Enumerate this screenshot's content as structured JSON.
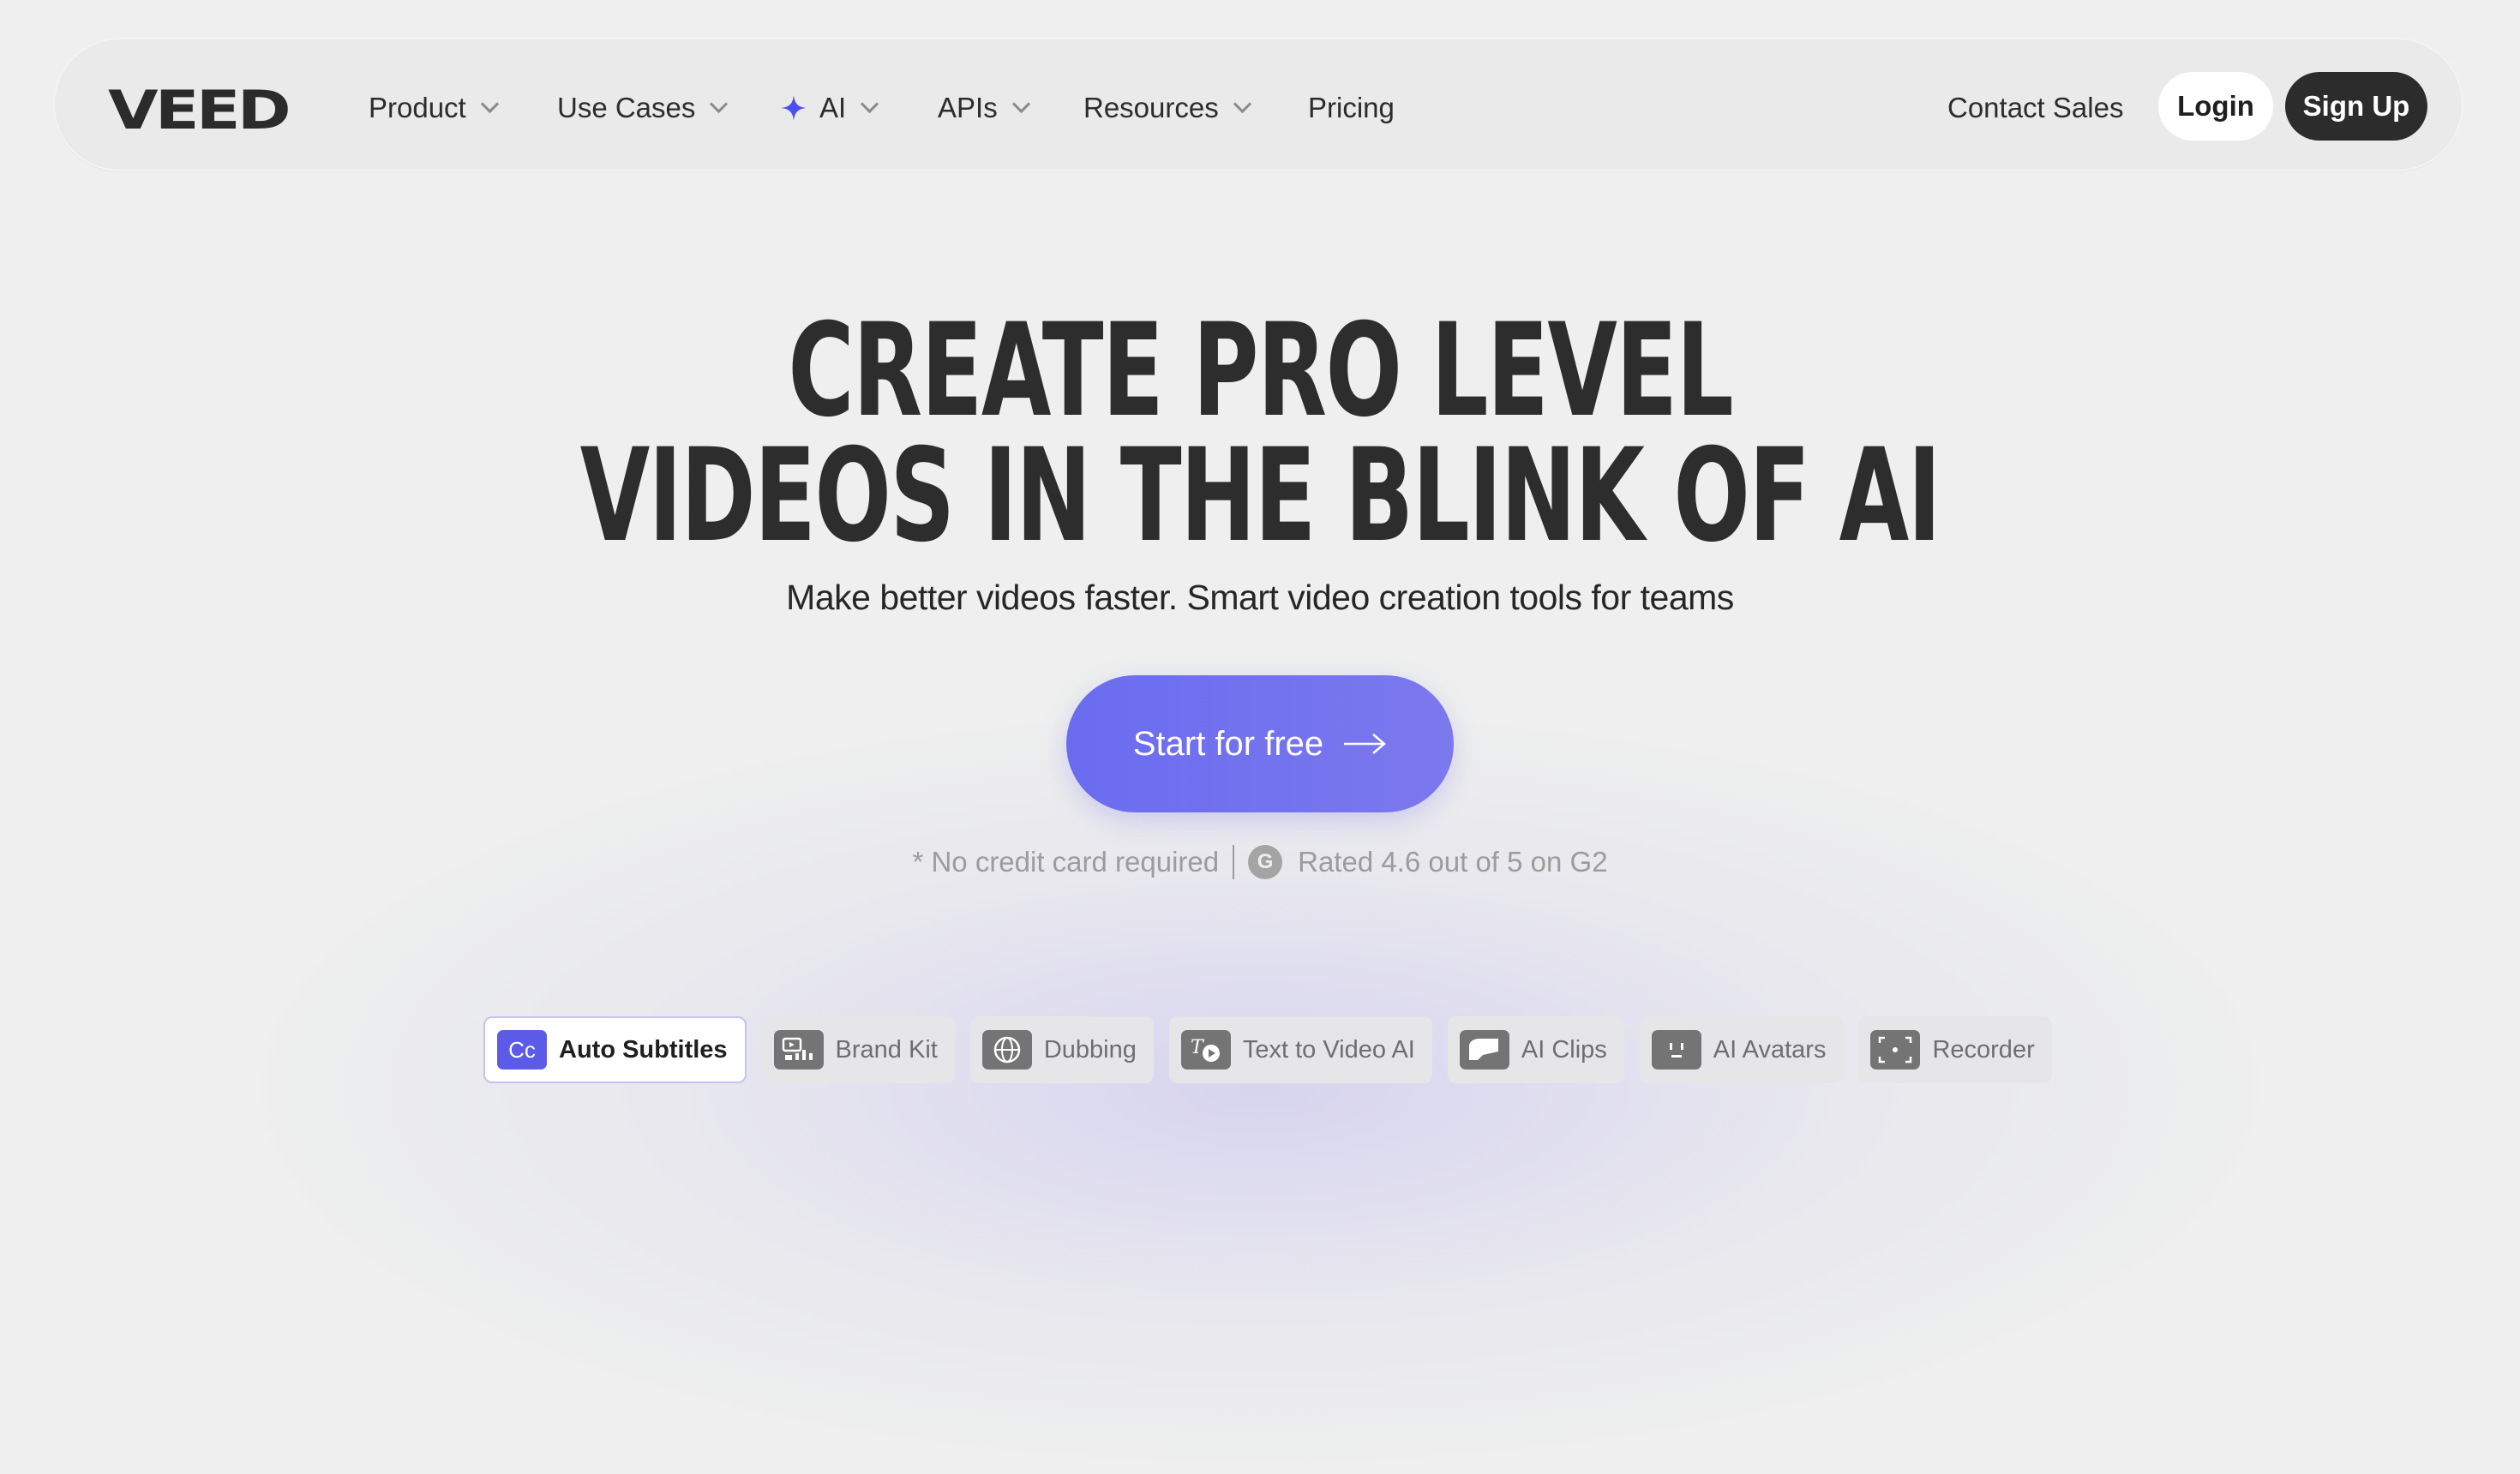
{
  "brand": {
    "logo_text": "VEED",
    "accent_color": "#6a6cf0",
    "ai_icon_color": "#4b4ef0"
  },
  "nav": {
    "items": [
      {
        "label": "Product",
        "has_dropdown": true
      },
      {
        "label": "Use Cases",
        "has_dropdown": true
      },
      {
        "label": "AI",
        "has_dropdown": true,
        "icon": "sparkle-icon"
      },
      {
        "label": "APIs",
        "has_dropdown": true
      },
      {
        "label": "Resources",
        "has_dropdown": true
      },
      {
        "label": "Pricing",
        "has_dropdown": false
      }
    ],
    "contact_sales": "Contact Sales",
    "login": "Login",
    "signup": "Sign Up"
  },
  "hero": {
    "headline_line1": "CREATE PRO LEVEL",
    "headline_line2": "VIDEOS IN THE BLINK OF AI",
    "subtitle": "Make better videos faster. Smart video creation tools for teams",
    "cta_label": "Start for free",
    "no_card": "* No credit card required",
    "rating": "Rated 4.6 out of 5 on G2"
  },
  "feature_tabs": [
    {
      "label": "Auto Subtitles",
      "icon": "captions-icon",
      "icon_text": "Cc",
      "active": true
    },
    {
      "label": "Brand Kit",
      "icon": "brand-kit-icon",
      "active": false
    },
    {
      "label": "Dubbing",
      "icon": "globe-translate-icon",
      "active": false
    },
    {
      "label": "Text to Video AI",
      "icon": "text-to-video-icon",
      "icon_text": "T",
      "active": false
    },
    {
      "label": "AI Clips",
      "icon": "clips-icon",
      "active": false
    },
    {
      "label": "AI Avatars",
      "icon": "avatar-icon",
      "active": false
    },
    {
      "label": "Recorder",
      "icon": "recorder-icon",
      "active": false
    }
  ]
}
